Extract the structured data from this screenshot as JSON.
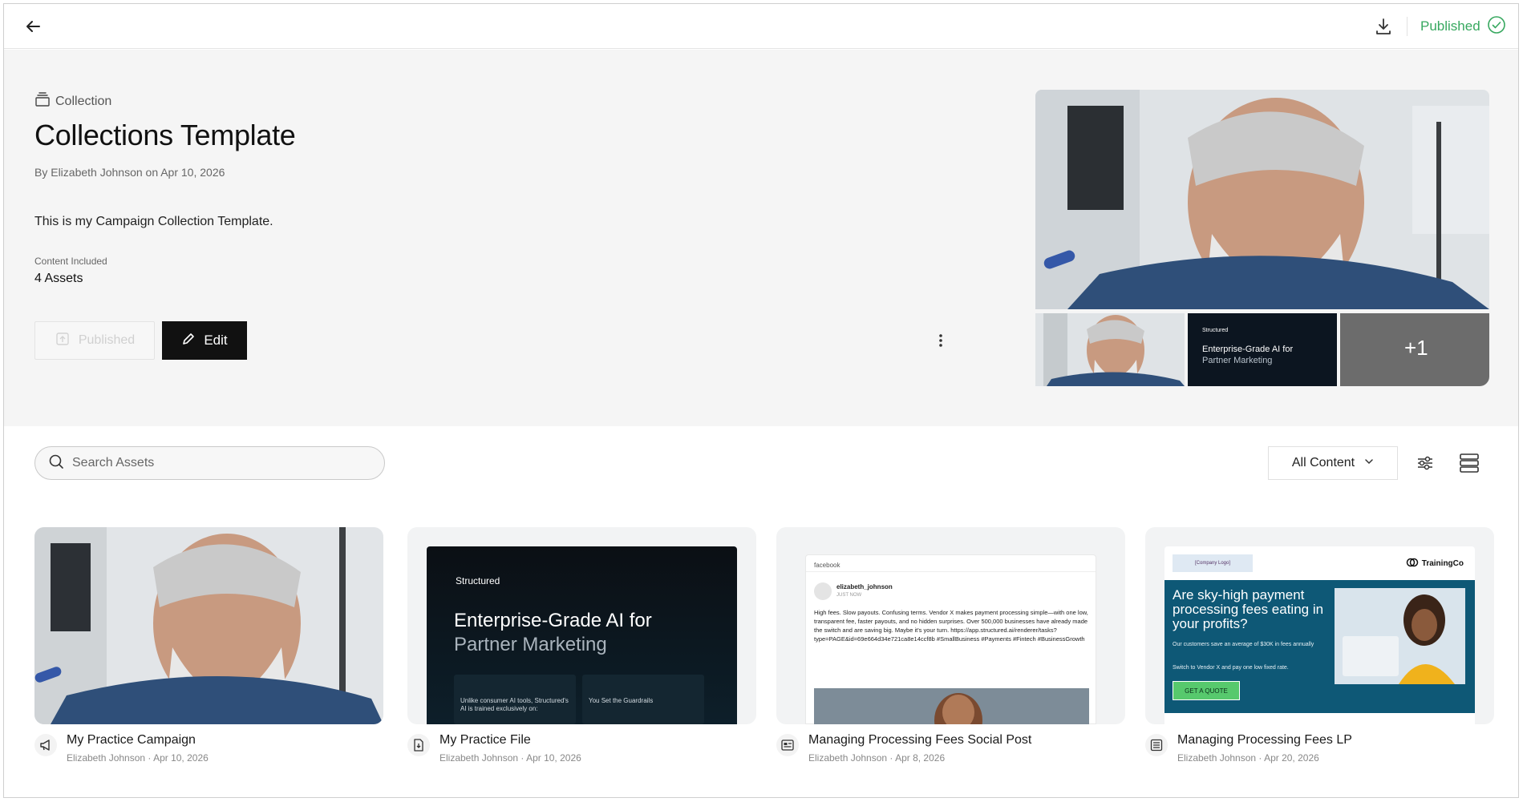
{
  "topbar": {
    "status_label": "Published",
    "status_color": "#37a85f",
    "back_icon": "arrow-left-icon",
    "download_icon": "download-icon",
    "status_icon": "check-circle-icon"
  },
  "hero": {
    "kind_label": "Collection",
    "kind_icon": "collection-stack-icon",
    "title": "Collections Template",
    "byline": "By Elizabeth Johnson on Apr 10, 2026",
    "description": "This is my Campaign Collection Template.",
    "content_label": "Content Included",
    "content_value": "4 Assets",
    "published_button": "Published",
    "edit_button": "Edit",
    "more_icon": "more-vertical-icon",
    "thumb_doc_brand": "Structured",
    "thumb_doc_title": "Enterprise-Grade AI for",
    "thumb_doc_title_dim": "Partner Marketing",
    "thumb_more_count": "+1"
  },
  "toolbar": {
    "search_placeholder": "Search Assets",
    "search_value": "",
    "filter_selected": "All Content",
    "settings_icon": "sliders-icon",
    "view_icon": "list-view-icon"
  },
  "assets": [
    {
      "title": "My Practice Campaign",
      "subtitle": "Elizabeth Johnson · Apr 10, 2026",
      "icon": "megaphone-icon"
    },
    {
      "title": "My Practice File",
      "subtitle": "Elizabeth Johnson · Apr 10, 2026",
      "icon": "file-download-icon",
      "preview": {
        "brand": "Structured",
        "headline": "Enterprise-Grade AI for",
        "headline_dim": "Partner Marketing",
        "panel1": "Unlike consumer AI tools, Structured's AI is trained exclusively on:",
        "panel2": "You Set the Guardrails"
      }
    },
    {
      "title": "Managing Processing Fees Social Post",
      "subtitle": "Elizabeth Johnson · Apr 8, 2026",
      "icon": "social-post-icon",
      "preview": {
        "network": "facebook",
        "user": "elizabeth_johnson",
        "time": "JUST NOW",
        "text": "High fees. Slow payouts. Confusing terms. Vendor X makes payment processing simple—with one low, transparent fee, faster payouts, and no hidden surprises. Over 500,000 businesses have already made the switch and are saving big. Maybe it's your turn. https://app.structured.ai/renderer/tasks?type=PAGE&id=69e664d34e721ca8e14ccf8b #SmallBusiness #Payments #Fintech #BusinessGrowth"
      }
    },
    {
      "title": "Managing Processing Fees LP",
      "subtitle": "Elizabeth Johnson · Apr 20, 2026",
      "icon": "landing-page-icon",
      "preview": {
        "logo_placeholder": "[Company Logo]",
        "brand": "TrainingCo",
        "headline": "Are sky-high payment processing fees eating in your profits?",
        "sub1": "Our customers save an average of $30K in fees annually",
        "sub2": "Switch to Vendor X and pay one low fixed rate.",
        "cta": "GET A QUOTE"
      }
    }
  ]
}
